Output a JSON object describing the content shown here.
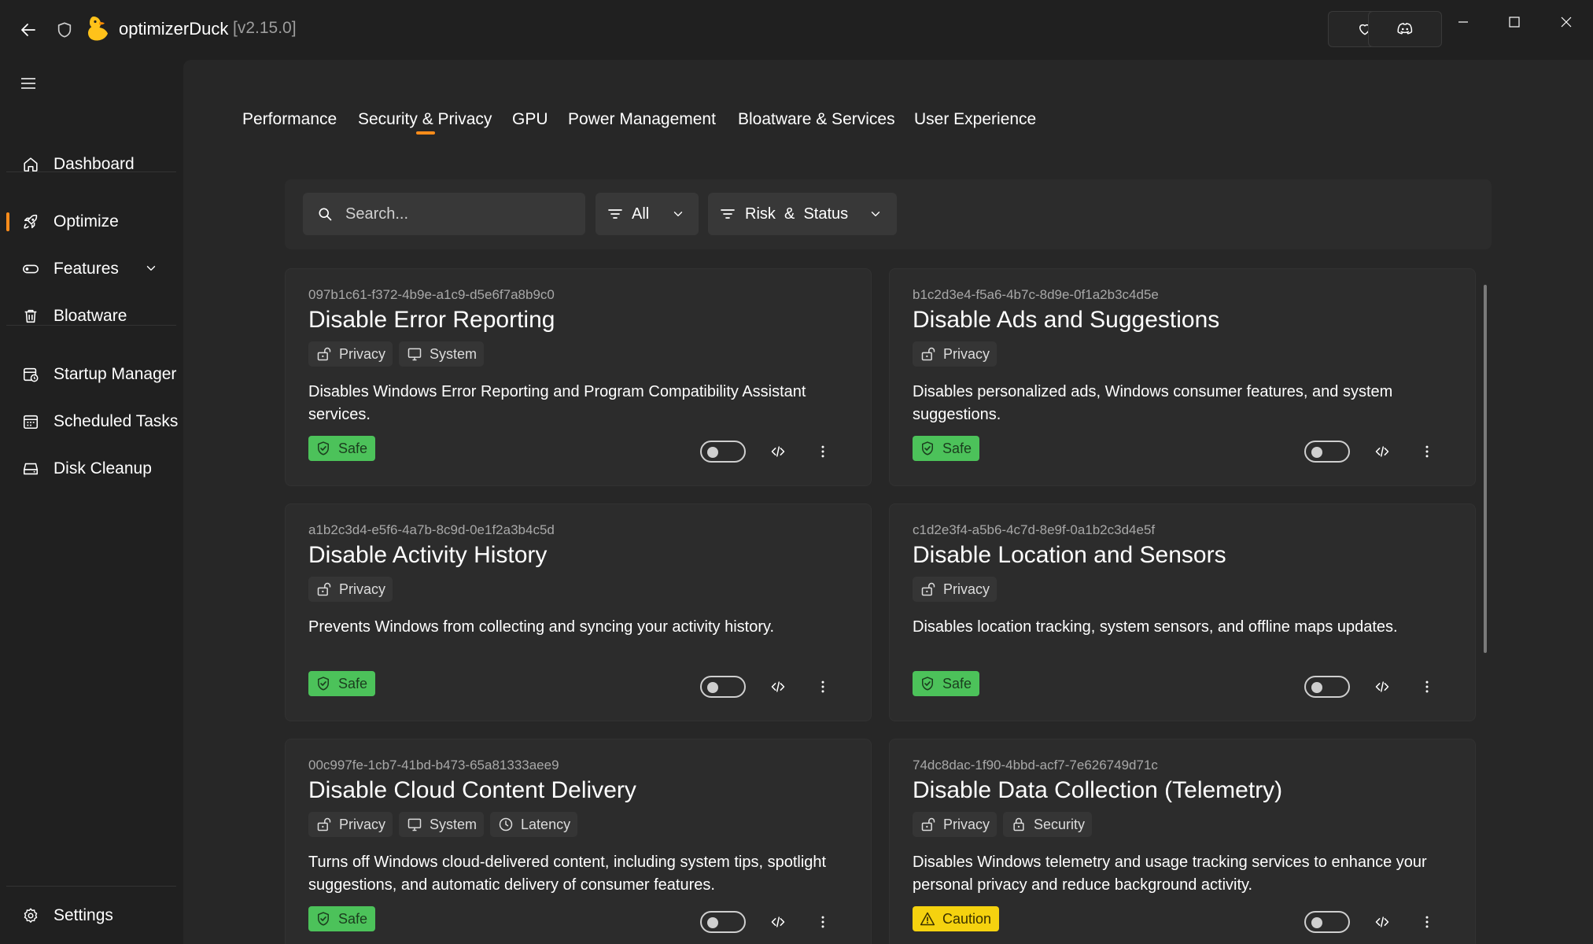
{
  "app": {
    "title": "optimizerDuck",
    "version": "[v2.15.0]"
  },
  "titlebar": {
    "back_icon": "arrow-left-icon",
    "shield_icon": "shield-icon",
    "logo_icon": "duck-logo-icon",
    "favorite_icon": "heart-icon",
    "community_icon": "discord-icon",
    "window_controls": [
      "minimize",
      "maximize",
      "close"
    ]
  },
  "sidebar": {
    "items": [
      {
        "label": "Dashboard",
        "icon": "home-icon"
      },
      {
        "label": "Optimize",
        "icon": "rocket-icon",
        "active": true
      },
      {
        "label": "Features",
        "icon": "toggle-icon",
        "expandable": true
      },
      {
        "label": "Bloatware",
        "icon": "trash-icon"
      },
      {
        "label": "Startup Manager",
        "icon": "startup-icon"
      },
      {
        "label": "Scheduled Tasks",
        "icon": "calendar-icon"
      },
      {
        "label": "Disk Cleanup",
        "icon": "disk-icon"
      }
    ],
    "settings": {
      "label": "Settings",
      "icon": "gear-icon"
    }
  },
  "tabs": [
    {
      "label": "Performance"
    },
    {
      "label": "Security & Privacy",
      "active": true
    },
    {
      "label": "GPU"
    },
    {
      "label": "Power Management"
    },
    {
      "label": "Bloatware & Services"
    },
    {
      "label": "User Experience"
    }
  ],
  "filters": {
    "search_placeholder": "Search...",
    "category": "All",
    "risk_status": "Risk  &  Status"
  },
  "colors": {
    "accent": "#ff8c1a",
    "safe": "#4cc25a",
    "caution": "#f5d20f"
  },
  "cards": [
    {
      "id": "097b1c61-f372-4b9e-a1c9-d5e6f7a8b9c0",
      "title": "Disable Error Reporting",
      "tags": [
        {
          "label": "Privacy",
          "icon": "privacy-icon"
        },
        {
          "label": "System",
          "icon": "monitor-icon"
        }
      ],
      "description": "Disables Windows Error Reporting and Program Compatibility Assistant services.",
      "risk": "Safe",
      "enabled": false
    },
    {
      "id": "b1c2d3e4-f5a6-4b7c-8d9e-0f1a2b3c4d5e",
      "title": "Disable Ads and Suggestions",
      "tags": [
        {
          "label": "Privacy",
          "icon": "privacy-icon"
        }
      ],
      "description": "Disables personalized ads, Windows consumer features, and system suggestions.",
      "risk": "Safe",
      "enabled": false
    },
    {
      "id": "a1b2c3d4-e5f6-4a7b-8c9d-0e1f2a3b4c5d",
      "title": "Disable Activity History",
      "tags": [
        {
          "label": "Privacy",
          "icon": "privacy-icon"
        }
      ],
      "description": "Prevents Windows from collecting and syncing your activity history.",
      "risk": "Safe",
      "enabled": false
    },
    {
      "id": "c1d2e3f4-a5b6-4c7d-8e9f-0a1b2c3d4e5f",
      "title": "Disable Location and Sensors",
      "tags": [
        {
          "label": "Privacy",
          "icon": "privacy-icon"
        }
      ],
      "description": "Disables location tracking, system sensors, and offline maps updates.",
      "risk": "Safe",
      "enabled": false
    },
    {
      "id": "00c997fe-1cb7-41bd-b473-65a81333aee9",
      "title": "Disable Cloud Content Delivery",
      "tags": [
        {
          "label": "Privacy",
          "icon": "privacy-icon"
        },
        {
          "label": "System",
          "icon": "monitor-icon"
        },
        {
          "label": "Latency",
          "icon": "clock-icon"
        }
      ],
      "description": "Turns off Windows cloud-delivered content, including system tips, spotlight suggestions, and automatic delivery of consumer features.",
      "risk": "Safe",
      "enabled": false
    },
    {
      "id": "74dc8dac-1f90-4bbd-acf7-7e626749d71c",
      "title": "Disable Data Collection (Telemetry)",
      "tags": [
        {
          "label": "Privacy",
          "icon": "privacy-icon"
        },
        {
          "label": "Security",
          "icon": "lock-icon"
        }
      ],
      "description": "Disables Windows telemetry and usage tracking services to enhance your personal privacy and reduce background activity.",
      "risk": "Caution",
      "enabled": false
    }
  ]
}
